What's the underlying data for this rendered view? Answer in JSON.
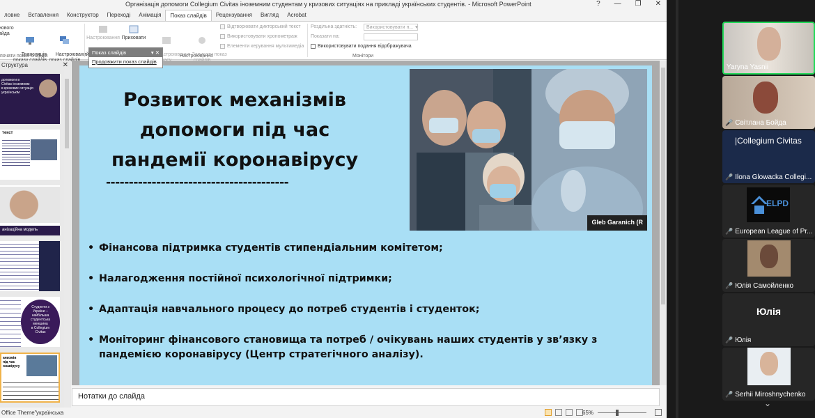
{
  "window": {
    "title": "Організація допомоги Collegium Civitas іноземним студентам у кризових ситуаціях на прикладі українських студентів. - Microsoft PowerPoint"
  },
  "ribbon": {
    "tabs": [
      "ловне",
      "Вставлення",
      "Конструктор",
      "Переході",
      "Анімація",
      "Показ слайдів",
      "Рецензування",
      "Вигляд",
      "Acrobat"
    ],
    "buttons": {
      "partial_left": "нового\nайда",
      "broadcast": "Трансляція\nпоказу слайдів",
      "custom": "Настроюваний\nпоказ слайдів",
      "setup": "Настроювання",
      "hide": "Приховати",
      "rehearse": "Настроювання\nчасу",
      "record": "Записати показ\nслайдів"
    },
    "checkboxes": [
      "Відтворювати дикторський текст",
      "Використовувати хронометраж",
      "Елементи керування мультимедіа"
    ],
    "resolution_label": "Роздільна здатність:",
    "resolution_value": "Використовувати п...",
    "show_on_label": "Показати на:",
    "presenter_view": "Використовувати подання відображувача",
    "group_start": "почати показ слайдів",
    "group_setup": "Настроювання",
    "group_monitors": "Монітори"
  },
  "popup": {
    "header": "Показ слайдів",
    "item": "Продовжити показ слайдів"
  },
  "side_panel": {
    "tab_label": "Структура"
  },
  "slide": {
    "title": "Розвиток механізмів допомоги під час пандемії коронавірусу",
    "dashes": "----------------------------------------",
    "photo_caption": "Gleb Garanich (R",
    "bullets": [
      "Фінансова підтримка студентів стипендіальним комітетом;",
      "Налагодження постійної психологічної підтримки;",
      "Адаптація навчального процесу до потреб студентів і студенток;",
      "Моніторинг фінансового становища та потреб / очікувань наших студентів у зв’язку з пандемією коронавірусу (Центр стратегічного аналізу)."
    ]
  },
  "thumbnails": {
    "t1": "допомоги в\nCivitas іноземним\nв кризових ситуація\nукраїнськім",
    "t2": "текст",
    "t3": "анізаційна модель",
    "t5": "Студенти з\nУкраїни –\nнайбільша\nстудентська\nменшина\nв Collegium\nCivitas",
    "t6": "анизмів\nпід час\nонавірусу"
  },
  "notes": {
    "placeholder": "Нотатки до слайда"
  },
  "status": {
    "theme": "Office Theme\"",
    "language": "українська",
    "zoom": "65%"
  },
  "participants": [
    {
      "name": "Yaryna Yasnii",
      "muted": false
    },
    {
      "name": "Світлана Бойда",
      "muted": true
    },
    {
      "name": "Ilona Glowacka Collegi...",
      "muted": true
    },
    {
      "name": "European League of Pr...",
      "muted": true
    },
    {
      "name": "Юлія Самойленко",
      "muted": true
    },
    {
      "name": "Юлія",
      "muted": true,
      "big_label": "Юлія"
    },
    {
      "name": "Serhii Miroshnychenko",
      "muted": true
    }
  ],
  "tile_texts": {
    "collegium": "|Collegium Civitas",
    "elpd": "ELPD"
  }
}
